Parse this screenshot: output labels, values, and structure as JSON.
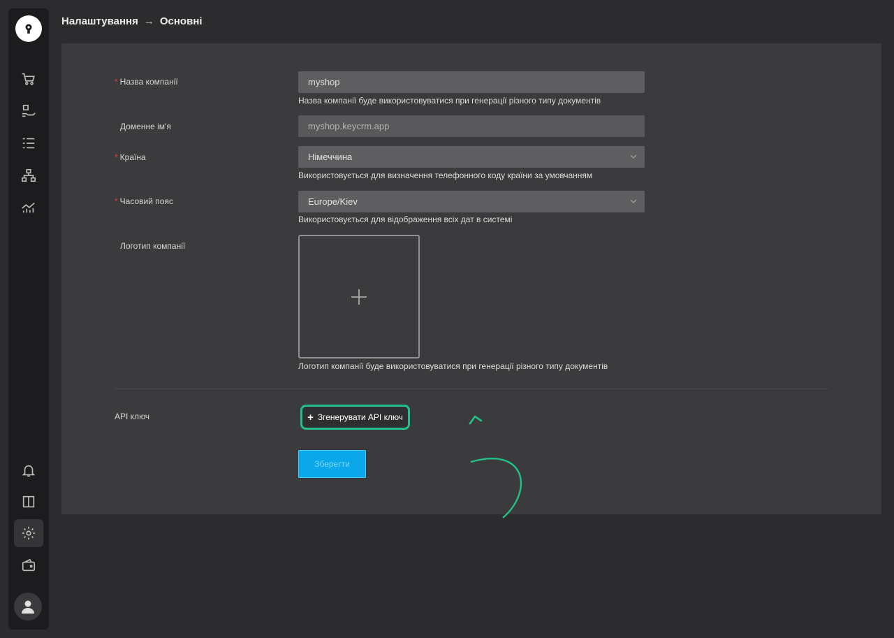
{
  "breadcrumb": {
    "parent": "Налаштування",
    "separator": "→",
    "current": "Основні"
  },
  "form": {
    "company_name": {
      "label": "Назва компанії",
      "value": "myshop",
      "hint": "Назва компанії буде використовуватися при генерації різного типу документів"
    },
    "domain": {
      "label": "Доменне ім'я",
      "value": "myshop.keycrm.app"
    },
    "country": {
      "label": "Країна",
      "value": "Німеччина",
      "hint": "Використовується для визначення телефонного коду країни за умовчанням"
    },
    "timezone": {
      "label": "Часовий пояс",
      "value": "Europe/Kiev",
      "hint": "Використовується для відображення всіх дат в системі"
    },
    "logo": {
      "label": "Логотип компанії",
      "hint": "Логотип компанії буде використовуватися при генерації різного типу документів"
    },
    "api_key": {
      "label": "API ключ",
      "button_label": "Згенерувати API ключ"
    },
    "save_label": "Зберегти"
  },
  "colors": {
    "accent": "#0aa8e8",
    "highlight": "#22c08c",
    "required": "#e53935"
  },
  "sidebar": {
    "icons": [
      "cart-icon",
      "box-hand-icon",
      "checklist-icon",
      "hierarchy-icon",
      "analytics-icon",
      "bell-icon",
      "book-icon",
      "gear-icon",
      "wallet-icon",
      "user-icon"
    ]
  }
}
